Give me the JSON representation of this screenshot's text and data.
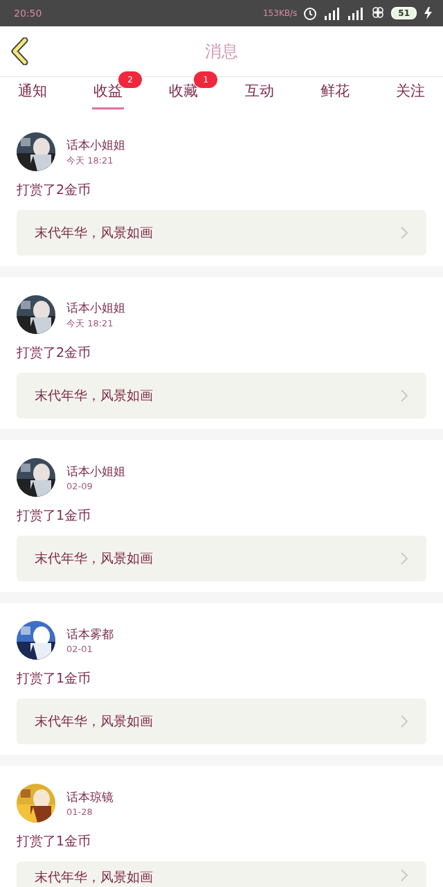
{
  "status_bar": {
    "time": "20:50",
    "speed": "153KB/s",
    "battery": "51"
  },
  "header": {
    "title": "消息"
  },
  "tabs": [
    {
      "label": "通知",
      "selected": false
    },
    {
      "label": "收益",
      "selected": true,
      "badge": "2"
    },
    {
      "label": "收藏",
      "selected": false,
      "badge": "1"
    },
    {
      "label": "互动",
      "selected": false
    },
    {
      "label": "鲜花",
      "selected": false
    },
    {
      "label": "关注",
      "selected": false
    }
  ],
  "messages": [
    {
      "user": "话本小姐姐",
      "time": "今天 18:21",
      "text": "打赏了2金币",
      "work": "末代年华，风景如画"
    },
    {
      "user": "话本小姐姐",
      "time": "今天 18:21",
      "text": "打赏了2金币",
      "work": "末代年华，风景如画"
    },
    {
      "user": "话本小姐姐",
      "time": "02-09",
      "text": "打赏了1金币",
      "work": "末代年华，风景如画"
    },
    {
      "user": "话本雾都",
      "time": "02-01",
      "text": "打赏了1金币",
      "work": "末代年华，风景如画"
    },
    {
      "user": "话本琼镜",
      "time": "01-28",
      "text": "打赏了1金币",
      "work": "末代年华，风景如画"
    }
  ]
}
